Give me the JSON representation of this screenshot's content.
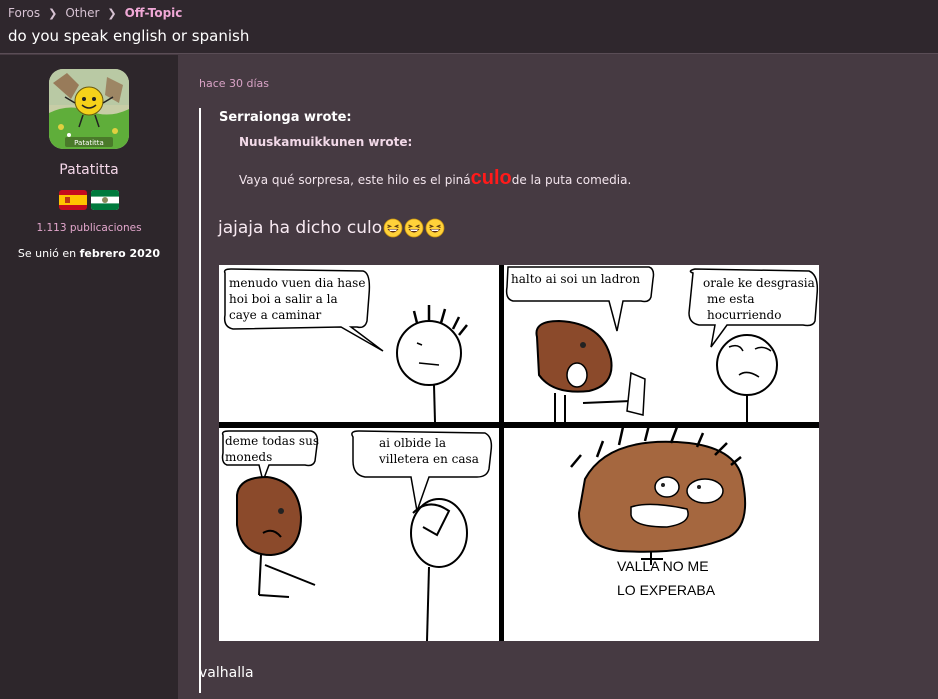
{
  "breadcrumb": {
    "items": [
      {
        "label": "Foros"
      },
      {
        "label": "Other"
      },
      {
        "label": "Off-Topic"
      }
    ]
  },
  "thread": {
    "title": "do you speak english or spanish"
  },
  "author": {
    "username": "Patatitta",
    "avatar_caption": "Patatitta",
    "posts": "1.113 publicaciones",
    "joined_prefix": "Se unió en ",
    "joined_date": "febrero 2020",
    "flags": [
      "spain-flag",
      "andalusia-flag"
    ]
  },
  "post": {
    "timestamp": "hace 30 días",
    "quote": {
      "author": "Serraionga wrote:",
      "nested": {
        "author": "Nuuskamuikkunen wrote:",
        "text_before": "Vaya qué sorpresa, este hilo es el piná",
        "text_highlight": "culo",
        "text_after": " de la puta comedia."
      },
      "text": "jajaja ha dicho culo",
      "emojis": [
        "laughing-emoji",
        "laughing-emoji",
        "laughing-emoji"
      ]
    },
    "comic": {
      "panels": [
        {
          "speech": [
            "menudo vuen dia hase",
            "hoi boi a salir a la",
            "caye a caminar"
          ]
        },
        {
          "speech": [
            "halto ai soi un ladron"
          ],
          "speech2": [
            "orale ke desgrasia",
            "me esta",
            "hocurriendo"
          ]
        },
        {
          "speech": [
            "deme todas sus",
            "moneds"
          ],
          "speech2": [
            "ai olbide la",
            "villetera en casa"
          ]
        },
        {
          "caption": [
            "VALLA NO ME",
            "LO EXPERABA"
          ]
        }
      ]
    },
    "reply": "valhalla"
  },
  "colors": {
    "background": "#463a42",
    "sidebar": "#2d262b",
    "topbar": "#2f272d",
    "accent": "#f0a8d6",
    "highlight_red": "#ff1a1a"
  }
}
